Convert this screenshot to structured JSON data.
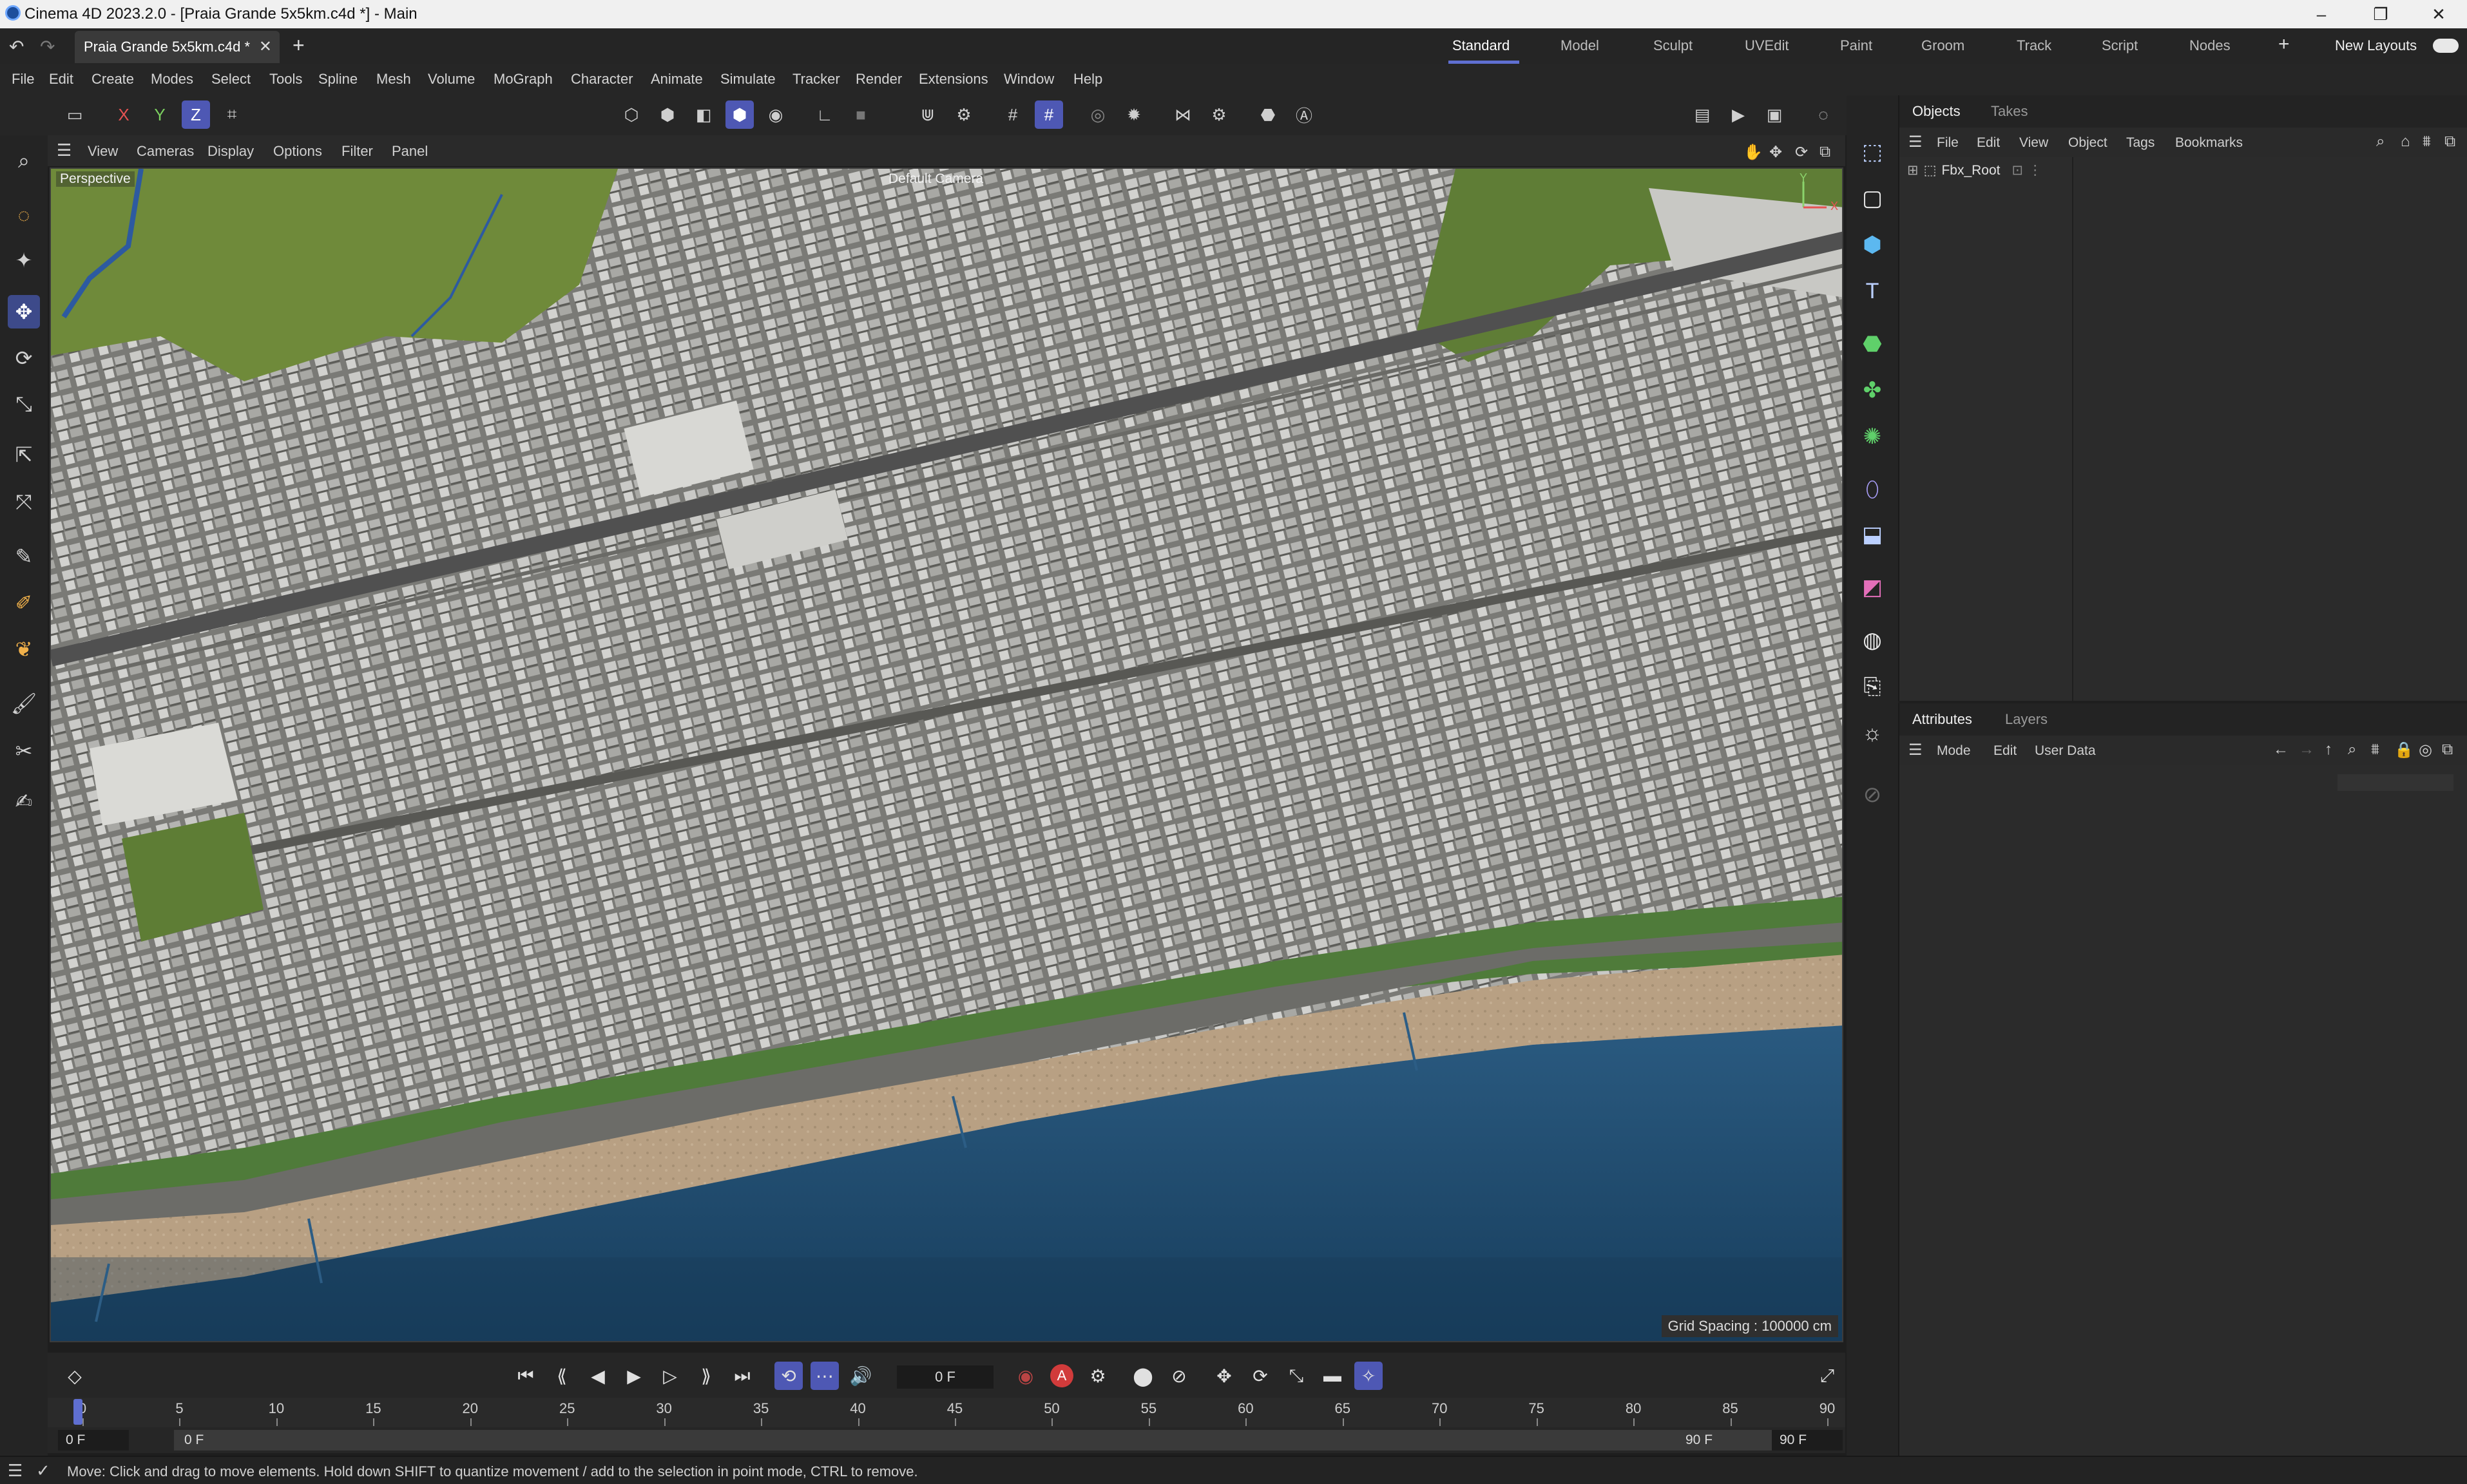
{
  "window": {
    "title": "Cinema 4D 2023.2.0 - [Praia Grande 5x5km.c4d *] - Main",
    "controls": [
      "–",
      "❐",
      "✕"
    ]
  },
  "tabs": {
    "document_tab": "Praia Grande 5x5km.c4d *",
    "new_tab": "+",
    "layouts": [
      "Standard",
      "Model",
      "Sculpt",
      "UVEdit",
      "Paint",
      "Groom",
      "Track",
      "Script",
      "Nodes"
    ],
    "active_layout": "Standard",
    "add_layout": "+",
    "new_layouts": "New Layouts"
  },
  "menu": [
    "File",
    "Edit",
    "Create",
    "Modes",
    "Select",
    "Tools",
    "Spline",
    "Mesh",
    "Volume",
    "MoGraph",
    "Character",
    "Animate",
    "Simulate",
    "Tracker",
    "Render",
    "Extensions",
    "Window",
    "Help"
  ],
  "toolbar": {
    "axis_x": "X",
    "axis_y": "Y",
    "axis_z": "Z"
  },
  "viewport": {
    "menu": [
      "View",
      "Cameras",
      "Display",
      "Options",
      "Filter",
      "Panel"
    ],
    "projection": "Perspective",
    "camera": "Default Camera",
    "grid_spacing": "Grid Spacing : 100000 cm",
    "axis_x": "X",
    "axis_y": "Y"
  },
  "objects_panel": {
    "tabs": [
      "Objects",
      "Takes"
    ],
    "active_tab": "Objects",
    "menu": [
      "File",
      "Edit",
      "View",
      "Object",
      "Tags",
      "Bookmarks"
    ],
    "items": [
      {
        "name": "Fbx_Root"
      }
    ]
  },
  "attributes_panel": {
    "tabs": [
      "Attributes",
      "Layers"
    ],
    "active_tab": "Attributes",
    "menu": [
      "Mode",
      "Edit",
      "User Data"
    ]
  },
  "timeline": {
    "current_frame": "0 F",
    "ticks": [
      "0",
      "5",
      "10",
      "15",
      "20",
      "25",
      "30",
      "35",
      "40",
      "45",
      "50",
      "55",
      "60",
      "65",
      "70",
      "75",
      "80",
      "85",
      "90"
    ],
    "range_start": "0 F",
    "range_min": "0 F",
    "range_end": "90 F",
    "range_max": "90 F",
    "record_label": "A"
  },
  "status": {
    "message": "Move: Click and drag to move elements. Hold down SHIFT to quantize movement / add to the selection in point mode, CTRL to remove."
  },
  "colors": {
    "accent": "#5f6fd1",
    "water": "#1f4d6e",
    "sand": "#b9a283",
    "grass": "#6f8a3a"
  }
}
